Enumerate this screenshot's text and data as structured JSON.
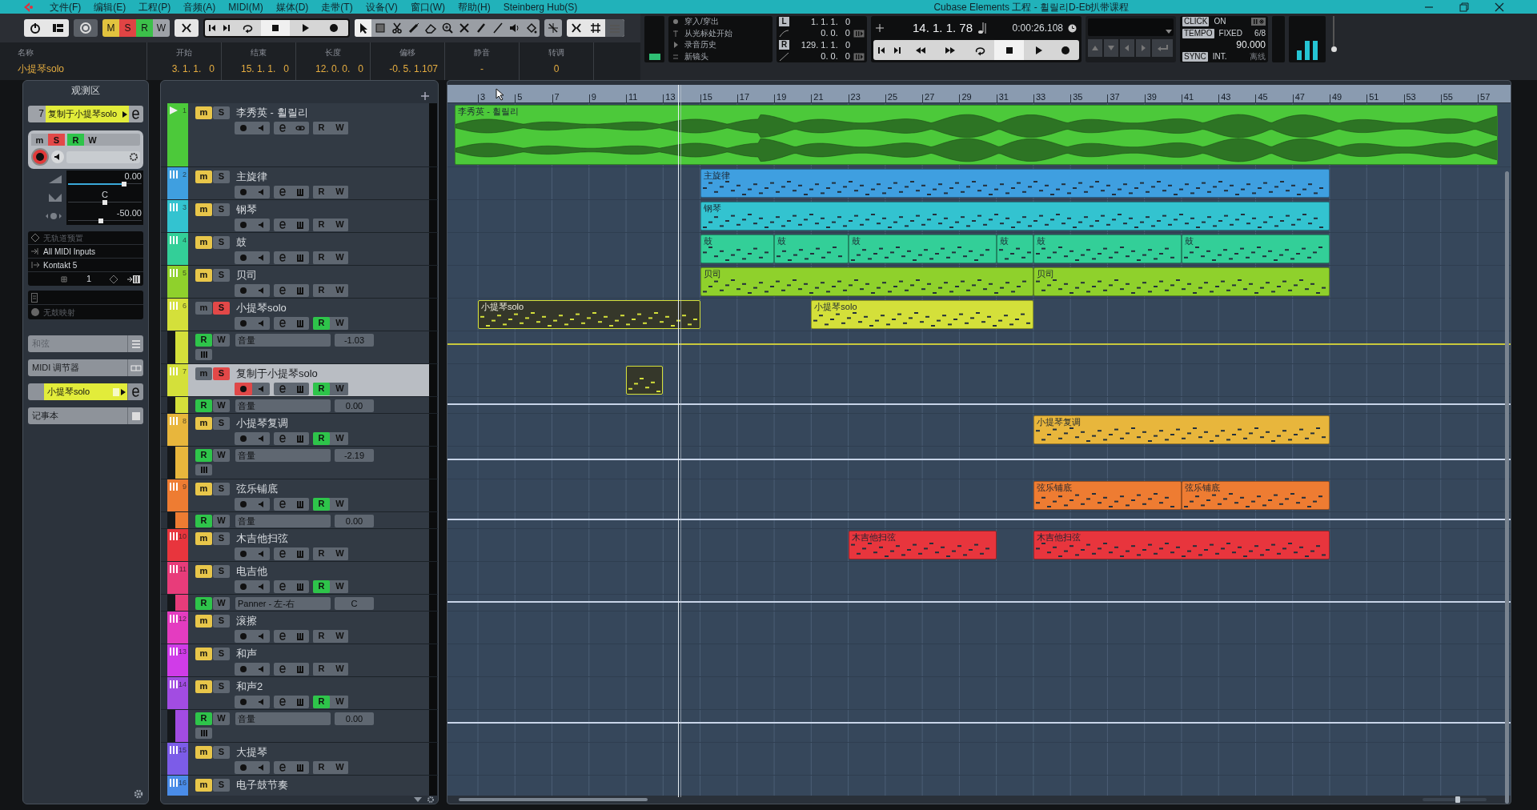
{
  "title_bar": {
    "title": "Cubase Elements 工程 - 휠릴리D-Eb扒带课程"
  },
  "menu": [
    "文件(F)",
    "编辑(E)",
    "工程(P)",
    "音频(A)",
    "MIDI(M)",
    "媒体(D)",
    "走带(T)",
    "设备(V)",
    "窗口(W)",
    "帮助(H)",
    "Steinberg Hub(S)"
  ],
  "mode_buttons": [
    {
      "label": "M",
      "on": true
    },
    {
      "label": "S",
      "on": true
    },
    {
      "label": "R",
      "on": true
    },
    {
      "label": "W",
      "on": false
    }
  ],
  "info_line": [
    {
      "label": "名称",
      "value": "小提琴solo"
    },
    {
      "label": "开始",
      "value": "3. 1. 1.   0"
    },
    {
      "label": "结束",
      "value": "15. 1. 1.   0"
    },
    {
      "label": "长度",
      "value": "12. 0. 0.   0"
    },
    {
      "label": "偏移",
      "value": "-0. 5. 1.107"
    },
    {
      "label": "静音",
      "value": "-"
    },
    {
      "label": "转调",
      "value": "0"
    }
  ],
  "transport": {
    "punch": [
      "穿入/穿出",
      "从光标处开始",
      "录音历史",
      "新镜头"
    ],
    "left_locator": {
      "label": "L",
      "value": "1. 1. 1.   0",
      "offset": "0. 0.   0"
    },
    "right_locator": {
      "label": "R",
      "value": "129. 1. 1.   0",
      "offset": "0. 0.   0"
    },
    "position": "14. 1. 1. 78",
    "time": "0:00:26.108",
    "click": {
      "label": "CLICK",
      "value": "ON"
    },
    "tempo": {
      "label": "TEMPO",
      "mode": "FIXED",
      "signature": "6/8",
      "value": "90.000"
    },
    "sync": {
      "label": "SYNC",
      "mode": "INT.",
      "status": "离线"
    }
  },
  "inspector": {
    "title": "观测区",
    "track_number": "7",
    "track_name": "复制于小提琴solo",
    "mute": {
      "label": "m",
      "on": false
    },
    "solo": {
      "label": "S",
      "on": true
    },
    "read": {
      "label": "R",
      "on": true
    },
    "write": {
      "label": "W",
      "on": false
    },
    "record": true,
    "volume": {
      "value": "0.00",
      "level": 0.76
    },
    "pan": {
      "value": "C",
      "level": 0.5
    },
    "delay": {
      "value": "-50.00",
      "level": 0.45
    },
    "routing": [
      {
        "kind": "preset",
        "label": "无轨道预置",
        "disabled": true
      },
      {
        "kind": "input",
        "label": "All MIDI Inputs",
        "disabled": false
      },
      {
        "kind": "output",
        "label": "Kontakt 5",
        "disabled": false
      }
    ],
    "channel": "1",
    "drum_map": {
      "label": "无鼓映射",
      "disabled": true
    },
    "sections": [
      {
        "kind": "chord",
        "label": "和弦",
        "disabled": true
      },
      {
        "kind": "plain",
        "label": "MIDI 调节器",
        "disabled": false
      },
      {
        "kind": "instrument",
        "label": "小提琴solo",
        "disabled": false
      },
      {
        "kind": "notes",
        "label": "记事本",
        "disabled": false
      }
    ]
  },
  "zoom": {
    "level": 0.55
  },
  "ruler": {
    "bars": [
      "3",
      "5",
      "7",
      "9",
      "11",
      "13",
      "15",
      "17",
      "19",
      "21",
      "23",
      "25",
      "27",
      "29",
      "31",
      "33",
      "35",
      "37",
      "39",
      "41",
      "43",
      "45",
      "47",
      "49",
      "51",
      "53",
      "55",
      "57"
    ]
  },
  "tracks": [
    {
      "number": "1",
      "name": "李秀英 - 휠릴리",
      "kind": "audio",
      "color": "#4cc93a",
      "selected": false,
      "mute": {
        "label": "m",
        "on": true
      },
      "solo": {
        "label": "S",
        "on": false
      },
      "record": false,
      "read": {
        "label": "R",
        "on": false
      },
      "write": {
        "label": "W",
        "on": false
      },
      "parts": [
        {
          "label": "李秀英 - 휠릴리",
          "selected": false
        }
      ]
    },
    {
      "number": "2",
      "name": "主旋律",
      "kind": "instrument",
      "color": "#3f9fe0",
      "selected": false,
      "mute": {
        "label": "m",
        "on": true
      },
      "solo": {
        "label": "S",
        "on": false
      },
      "record": false,
      "read": {
        "label": "R",
        "on": false
      },
      "write": {
        "label": "W",
        "on": false
      },
      "parts": [
        {
          "label": "主旋律",
          "selected": false
        }
      ]
    },
    {
      "number": "3",
      "name": "钢琴",
      "kind": "instrument",
      "color": "#33c3d0",
      "selected": false,
      "mute": {
        "label": "m",
        "on": true
      },
      "solo": {
        "label": "S",
        "on": false
      },
      "record": false,
      "read": {
        "label": "R",
        "on": false
      },
      "write": {
        "label": "W",
        "on": false
      },
      "parts": [
        {
          "label": "钢琴",
          "selected": false
        }
      ]
    },
    {
      "number": "4",
      "name": "鼓",
      "kind": "instrument",
      "color": "#33cf98",
      "selected": false,
      "mute": {
        "label": "m",
        "on": true
      },
      "solo": {
        "label": "S",
        "on": false
      },
      "record": false,
      "read": {
        "label": "R",
        "on": false
      },
      "write": {
        "label": "W",
        "on": false
      },
      "parts": [
        {
          "label": "鼓",
          "selected": false
        },
        {
          "label": "鼓",
          "selected": false
        },
        {
          "label": "鼓",
          "selected": false
        },
        {
          "label": "鼓",
          "selected": false
        },
        {
          "label": "鼓",
          "selected": false
        },
        {
          "label": "鼓",
          "selected": false
        }
      ]
    },
    {
      "number": "5",
      "name": "贝司",
      "kind": "instrument",
      "color": "#8fd12c",
      "selected": false,
      "mute": {
        "label": "m",
        "on": true
      },
      "solo": {
        "label": "S",
        "on": false
      },
      "record": false,
      "read": {
        "label": "R",
        "on": false
      },
      "write": {
        "label": "W",
        "on": false
      },
      "parts": [
        {
          "label": "贝司",
          "selected": false
        },
        {
          "label": "贝司",
          "selected": false
        }
      ]
    },
    {
      "number": "6",
      "name": "小提琴solo",
      "kind": "instrument",
      "color": "#d4e03a",
      "selected": false,
      "mute": {
        "label": "m",
        "on": false
      },
      "solo": {
        "label": "S",
        "on": true
      },
      "record": false,
      "read": {
        "label": "R",
        "on": true
      },
      "write": {
        "label": "W",
        "on": false
      },
      "parts": [
        {
          "label": "小提琴solo",
          "selected": true
        },
        {
          "label": "小提琴solo",
          "selected": false
        }
      ],
      "lane": {
        "kind": "full",
        "parameter": "音量",
        "value": "-1.03",
        "color": "#c8c83c",
        "read": {
          "label": "R",
          "on": true
        },
        "write": {
          "label": "W",
          "on": false
        }
      }
    },
    {
      "number": "7",
      "name": "复制于小提琴solo",
      "kind": "instrument",
      "color": "#d4e03a",
      "selected": true,
      "mute": {
        "label": "m",
        "on": false
      },
      "solo": {
        "label": "S",
        "on": true
      },
      "record": true,
      "read": {
        "label": "R",
        "on": true
      },
      "write": {
        "label": "W",
        "on": false
      },
      "parts": [
        {
          "selected": true
        }
      ],
      "lane": {
        "kind": "compact",
        "parameter": "音量",
        "value": "0.00",
        "color": "#c8d4e8",
        "read": {
          "label": "R",
          "on": true
        },
        "write": {
          "label": "W",
          "on": false
        }
      }
    },
    {
      "number": "8",
      "name": "小提琴复调",
      "kind": "instrument",
      "color": "#e8b63c",
      "selected": false,
      "mute": {
        "label": "m",
        "on": true
      },
      "solo": {
        "label": "S",
        "on": false
      },
      "record": false,
      "read": {
        "label": "R",
        "on": true
      },
      "write": {
        "label": "W",
        "on": false
      },
      "parts": [
        {
          "label": "小提琴复调",
          "selected": false
        }
      ],
      "lane": {
        "kind": "full",
        "parameter": "音量",
        "value": "-2.19",
        "color": "#c8d4e8",
        "read": {
          "label": "R",
          "on": true
        },
        "write": {
          "label": "W",
          "on": false
        }
      }
    },
    {
      "number": "9",
      "name": "弦乐铺底",
      "kind": "instrument",
      "color": "#ee7c32",
      "selected": false,
      "mute": {
        "label": "m",
        "on": true
      },
      "solo": {
        "label": "S",
        "on": false
      },
      "record": false,
      "read": {
        "label": "R",
        "on": true
      },
      "write": {
        "label": "W",
        "on": false
      },
      "parts": [
        {
          "label": "弦乐铺底",
          "selected": false
        },
        {
          "label": "弦乐铺底",
          "selected": false
        }
      ],
      "lane": {
        "kind": "compact",
        "parameter": "音量",
        "value": "0.00",
        "color": "#c8d4e8",
        "read": {
          "label": "R",
          "on": true
        },
        "write": {
          "label": "W",
          "on": false
        }
      }
    },
    {
      "number": "10",
      "name": "木吉他扫弦",
      "kind": "instrument",
      "color": "#e8353d",
      "selected": false,
      "mute": {
        "label": "m",
        "on": true
      },
      "solo": {
        "label": "S",
        "on": false
      },
      "record": false,
      "read": {
        "label": "R",
        "on": false
      },
      "write": {
        "label": "W",
        "on": false
      },
      "parts": [
        {
          "label": "木吉他扫弦",
          "selected": false
        },
        {
          "label": "木吉他扫弦",
          "selected": false
        }
      ]
    },
    {
      "number": "11",
      "name": "电吉他",
      "kind": "instrument",
      "color": "#e83c7a",
      "selected": false,
      "mute": {
        "label": "m",
        "on": true
      },
      "solo": {
        "label": "S",
        "on": false
      },
      "record": false,
      "read": {
        "label": "R",
        "on": true
      },
      "write": {
        "label": "W",
        "on": false
      },
      "lane": {
        "kind": "compact",
        "parameter": "Panner - 左-右",
        "value": "C",
        "color": "#c8d4e8",
        "read": {
          "label": "R",
          "on": true
        },
        "write": {
          "label": "W",
          "on": false
        }
      }
    },
    {
      "number": "12",
      "name": "滚擦",
      "kind": "instrument",
      "color": "#e43cc0",
      "selected": false,
      "mute": {
        "label": "m",
        "on": true
      },
      "solo": {
        "label": "S",
        "on": false
      },
      "record": false,
      "read": {
        "label": "R",
        "on": false
      },
      "write": {
        "label": "W",
        "on": false
      }
    },
    {
      "number": "13",
      "name": "和声",
      "kind": "instrument",
      "color": "#d03ce8",
      "selected": false,
      "mute": {
        "label": "m",
        "on": true
      },
      "solo": {
        "label": "S",
        "on": false
      },
      "record": false,
      "read": {
        "label": "R",
        "on": false
      },
      "write": {
        "label": "W",
        "on": false
      }
    },
    {
      "number": "14",
      "name": "和声2",
      "kind": "instrument",
      "color": "#a24ce2",
      "selected": false,
      "mute": {
        "label": "m",
        "on": true
      },
      "solo": {
        "label": "S",
        "on": false
      },
      "record": false,
      "read": {
        "label": "R",
        "on": true
      },
      "write": {
        "label": "W",
        "on": false
      },
      "lane": {
        "kind": "full",
        "parameter": "音量",
        "value": "0.00",
        "color": "#c8d4e8",
        "read": {
          "label": "R",
          "on": true
        },
        "write": {
          "label": "W",
          "on": false
        }
      }
    },
    {
      "number": "15",
      "name": "大提琴",
      "kind": "instrument",
      "color": "#7c5ce8",
      "selected": false,
      "mute": {
        "label": "m",
        "on": true
      },
      "solo": {
        "label": "S",
        "on": false
      },
      "record": false,
      "read": {
        "label": "R",
        "on": false
      },
      "write": {
        "label": "W",
        "on": false
      }
    },
    {
      "number": "16",
      "name": "电子鼓节奏",
      "kind": "instrument",
      "color": "#4a8ce8",
      "selected": false,
      "mute": {
        "label": "m",
        "on": true
      },
      "solo": {
        "label": "S",
        "on": false
      }
    }
  ]
}
